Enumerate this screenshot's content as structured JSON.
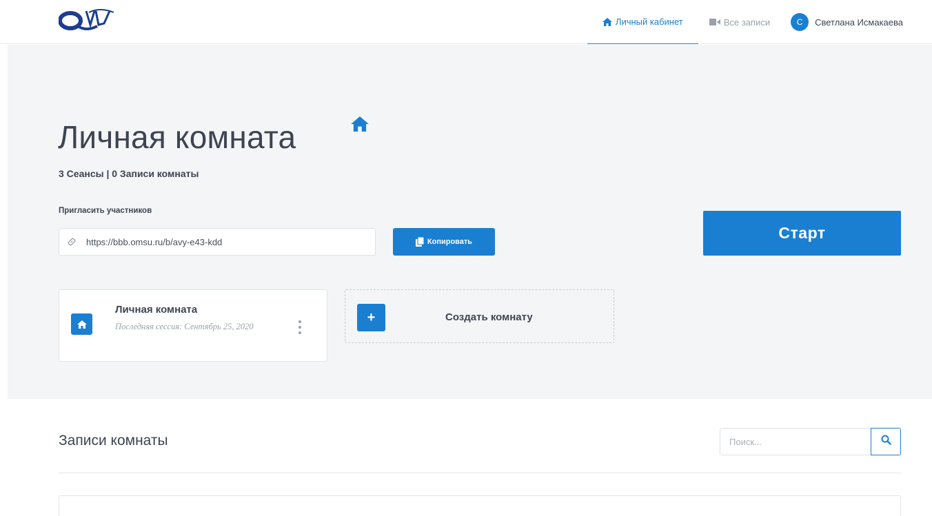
{
  "header": {
    "nav": {
      "home_label": "Личный кабинет",
      "recordings_label": "Все записи"
    },
    "user": {
      "initial": "С",
      "name": "Светлана Исмакаева"
    }
  },
  "room": {
    "title": "Личная комната",
    "stats": "3 Сеансы | 0 Записи комнаты",
    "invite_label": "Пригласить участников",
    "invite_url": "https://bbb.omsu.ru/b/avy-e43-kdd",
    "copy_label": "Копировать",
    "start_label": "Старт"
  },
  "rooms_list": [
    {
      "name": "Личная комната",
      "last_session": "Последняя сессия: Сентябрь 25, 2020"
    }
  ],
  "create_room": {
    "label": "Создать комнату"
  },
  "recordings": {
    "title": "Записи комнаты",
    "search_placeholder": "Поиск..."
  },
  "colors": {
    "accent": "#1a7fd1",
    "hero_bg": "#f4f5f7",
    "text_dark": "#3d4451",
    "text_muted": "#9aa0ac"
  },
  "icons": {
    "logo": "omsu-logo",
    "home": "home-icon",
    "video": "video-icon",
    "link": "link-icon",
    "copy": "copy-icon",
    "more": "more-vertical-icon",
    "plus": "plus-icon",
    "search": "search-icon"
  }
}
